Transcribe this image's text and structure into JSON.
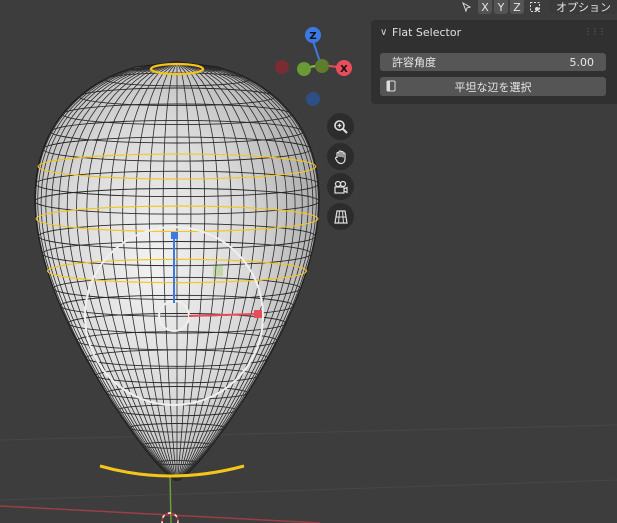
{
  "header": {
    "axis_buttons": [
      "X",
      "Y",
      "Z"
    ],
    "options_label": "オプション"
  },
  "gizmo": {
    "z_label": "Z",
    "x_label": "X"
  },
  "panel": {
    "title": "Flat Selector",
    "field_label": "許容角度",
    "field_value": "5.00",
    "button_label": "平坦な辺を選択"
  },
  "colors": {
    "viewport_bg": "#3d3d3d",
    "axis_x": "#e84d5b",
    "axis_y": "#8bc34a",
    "axis_z": "#3b7ae6",
    "selection": "#f5c518"
  }
}
